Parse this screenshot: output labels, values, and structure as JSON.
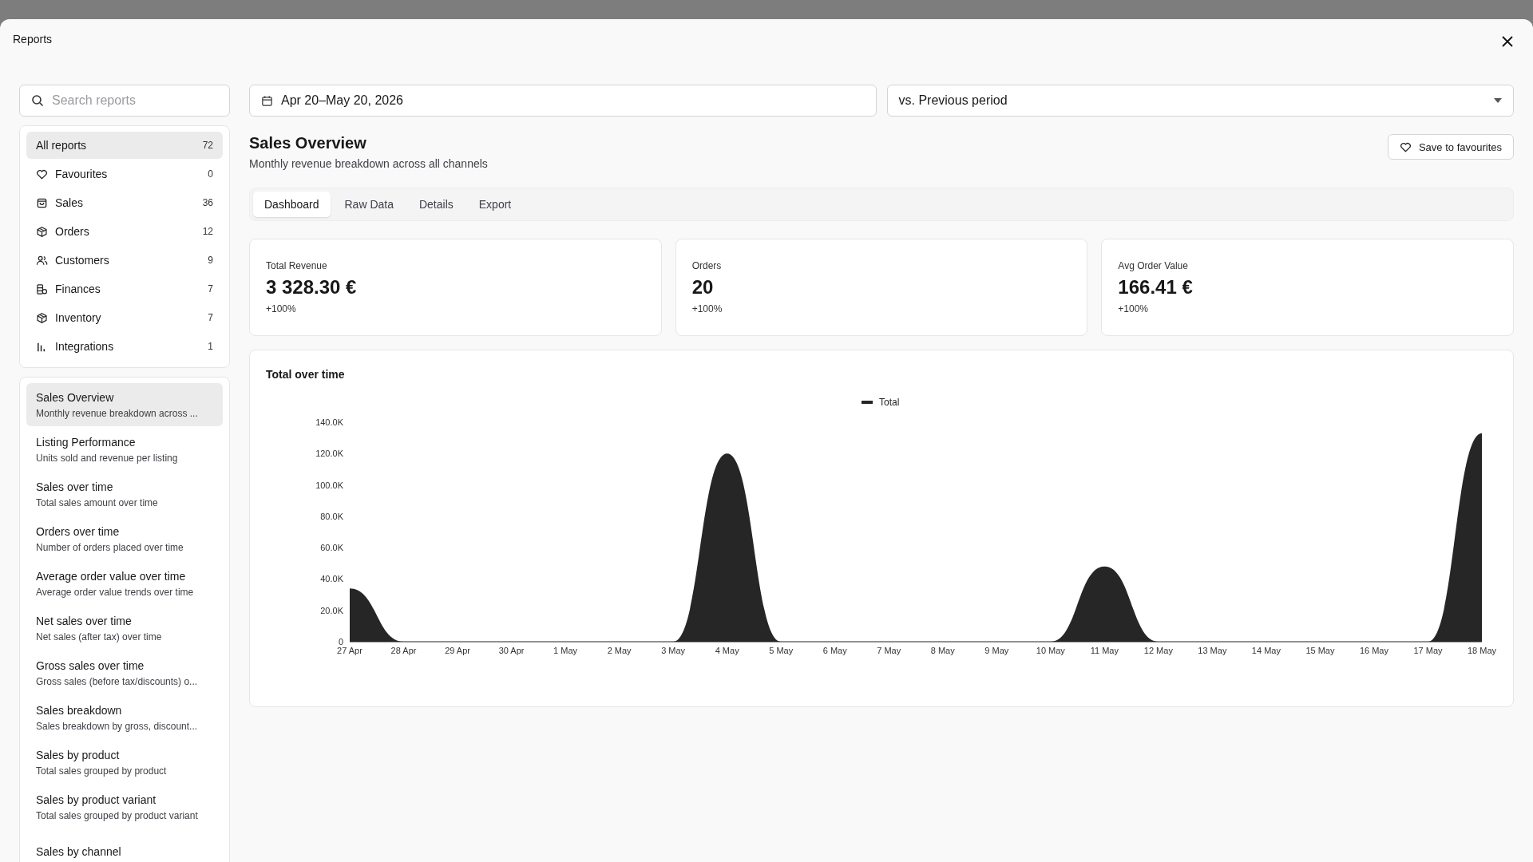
{
  "window": {
    "title": "Reports"
  },
  "search": {
    "placeholder": "Search reports"
  },
  "categories": [
    {
      "label": "All reports",
      "count": "72",
      "selected": true
    },
    {
      "label": "Favourites",
      "count": "0",
      "selected": false
    },
    {
      "label": "Sales",
      "count": "36",
      "selected": false
    },
    {
      "label": "Orders",
      "count": "12",
      "selected": false
    },
    {
      "label": "Customers",
      "count": "9",
      "selected": false
    },
    {
      "label": "Finances",
      "count": "7",
      "selected": false
    },
    {
      "label": "Inventory",
      "count": "7",
      "selected": false
    },
    {
      "label": "Integrations",
      "count": "1",
      "selected": false
    }
  ],
  "reports": [
    {
      "title": "Sales Overview",
      "description": "Monthly revenue breakdown across ...",
      "selected": true
    },
    {
      "title": "Listing Performance",
      "description": "Units sold and revenue per listing",
      "selected": false
    },
    {
      "title": "Sales over time",
      "description": "Total sales amount over time",
      "selected": false
    },
    {
      "title": "Orders over time",
      "description": "Number of orders placed over time",
      "selected": false
    },
    {
      "title": "Average order value over time",
      "description": "Average order value trends over time",
      "selected": false
    },
    {
      "title": "Net sales over time",
      "description": "Net sales (after tax) over time",
      "selected": false
    },
    {
      "title": "Gross sales over time",
      "description": "Gross sales (before tax/discounts) o...",
      "selected": false
    },
    {
      "title": "Sales breakdown",
      "description": "Sales breakdown by gross, discount...",
      "selected": false
    },
    {
      "title": "Sales by product",
      "description": "Total sales grouped by product",
      "selected": false
    },
    {
      "title": "Sales by product variant",
      "description": "Total sales grouped by product variant",
      "selected": false
    },
    {
      "title": "Sales by channel",
      "selected": false
    }
  ],
  "date_range": {
    "value": "Apr 20–May 20, 2026"
  },
  "comparison": {
    "value": "vs. Previous period"
  },
  "report": {
    "title": "Sales Overview",
    "subtitle": "Monthly revenue breakdown across all channels",
    "save_button": "Save to favourites"
  },
  "tabs": [
    {
      "label": "Dashboard",
      "selected": true
    },
    {
      "label": "Raw Data",
      "selected": false
    },
    {
      "label": "Details",
      "selected": false
    },
    {
      "label": "Export",
      "selected": false
    }
  ],
  "metrics": [
    {
      "label": "Total Revenue",
      "value": "3 328.30 €",
      "change": "+100%"
    },
    {
      "label": "Orders",
      "value": "20",
      "change": "+100%"
    },
    {
      "label": "Avg Order Value",
      "value": "166.41 €",
      "change": "+100%"
    }
  ],
  "chart": {
    "title": "Total over time",
    "chart_data": {
      "type": "area",
      "categories": [
        "27 Apr",
        "28 Apr",
        "29 Apr",
        "30 Apr",
        "1 May",
        "2 May",
        "3 May",
        "4 May",
        "5 May",
        "6 May",
        "7 May",
        "8 May",
        "9 May",
        "10 May",
        "11 May",
        "12 May",
        "13 May",
        "14 May",
        "15 May",
        "16 May",
        "17 May",
        "18 May"
      ],
      "series": [
        {
          "name": "Total",
          "color": "#262626",
          "values": [
            34000,
            0,
            0,
            0,
            0,
            0,
            0,
            120000,
            0,
            0,
            0,
            0,
            0,
            0,
            48000,
            0,
            0,
            0,
            0,
            0,
            0,
            133000
          ]
        }
      ],
      "ylim": [
        0,
        140000
      ],
      "yticks": [
        {
          "value": 0,
          "label": "0"
        },
        {
          "value": 20000,
          "label": "20.0K"
        },
        {
          "value": 40000,
          "label": "40.0K"
        },
        {
          "value": 60000,
          "label": "60.0K"
        },
        {
          "value": 80000,
          "label": "80.0K"
        },
        {
          "value": 100000,
          "label": "100.0K"
        },
        {
          "value": 120000,
          "label": "120.0K"
        },
        {
          "value": 140000,
          "label": "140.0K"
        }
      ]
    }
  }
}
